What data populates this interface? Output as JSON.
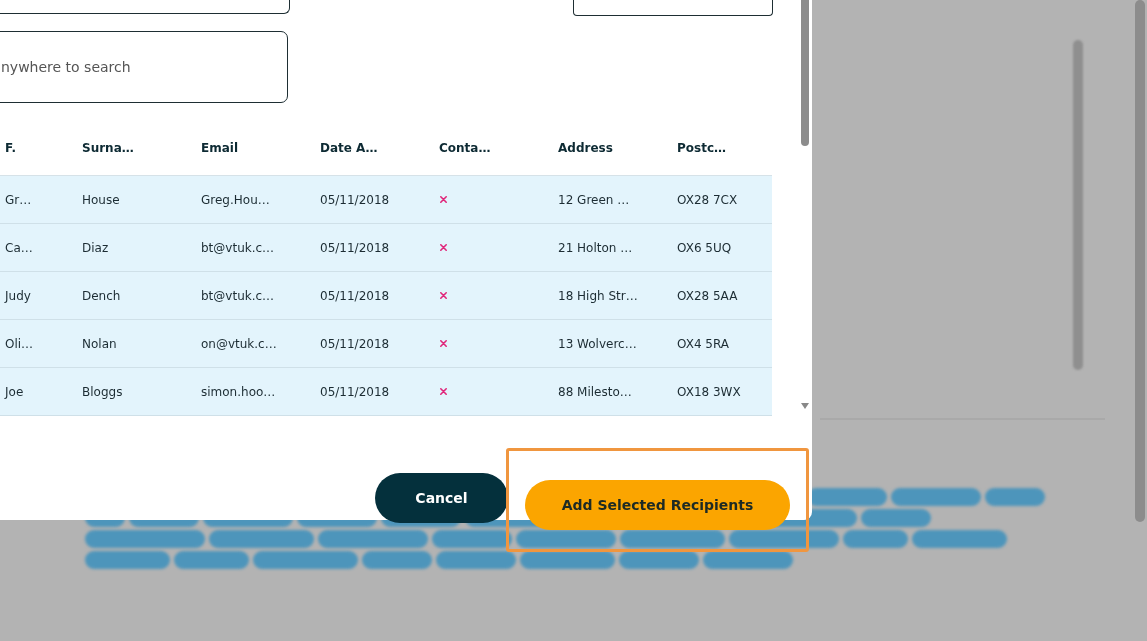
{
  "search": {
    "placeholder": "nywhere to search"
  },
  "table": {
    "columns": [
      "F.",
      "Surna…",
      "Email",
      "Date A…",
      "Conta…",
      "Address",
      "Postc…"
    ],
    "rows": [
      {
        "first": "Gr…",
        "surname": "House",
        "email": "Greg.Hou…",
        "date": "05/11/2018",
        "contact": false,
        "address": "12 Green …",
        "postcode": "OX28 7CX"
      },
      {
        "first": "Ca…",
        "surname": "Diaz",
        "email": "bt@vtuk.c…",
        "date": "05/11/2018",
        "contact": false,
        "address": "21 Holton …",
        "postcode": "OX6 5UQ"
      },
      {
        "first": "Judy",
        "surname": "Dench",
        "email": "bt@vtuk.c…",
        "date": "05/11/2018",
        "contact": false,
        "address": "18 High Str…",
        "postcode": "OX28 5AA"
      },
      {
        "first": "Oli…",
        "surname": "Nolan",
        "email": "on@vtuk.c…",
        "date": "05/11/2018",
        "contact": false,
        "address": "13 Wolverc…",
        "postcode": "OX4 5RA"
      },
      {
        "first": "Joe",
        "surname": "Bloggs",
        "email": "simon.hoo…",
        "date": "05/11/2018",
        "contact": false,
        "address": "88 Milesto…",
        "postcode": "OX18 3WX"
      }
    ]
  },
  "buttons": {
    "cancel": "Cancel",
    "confirm": "Add Selected Recipients"
  }
}
